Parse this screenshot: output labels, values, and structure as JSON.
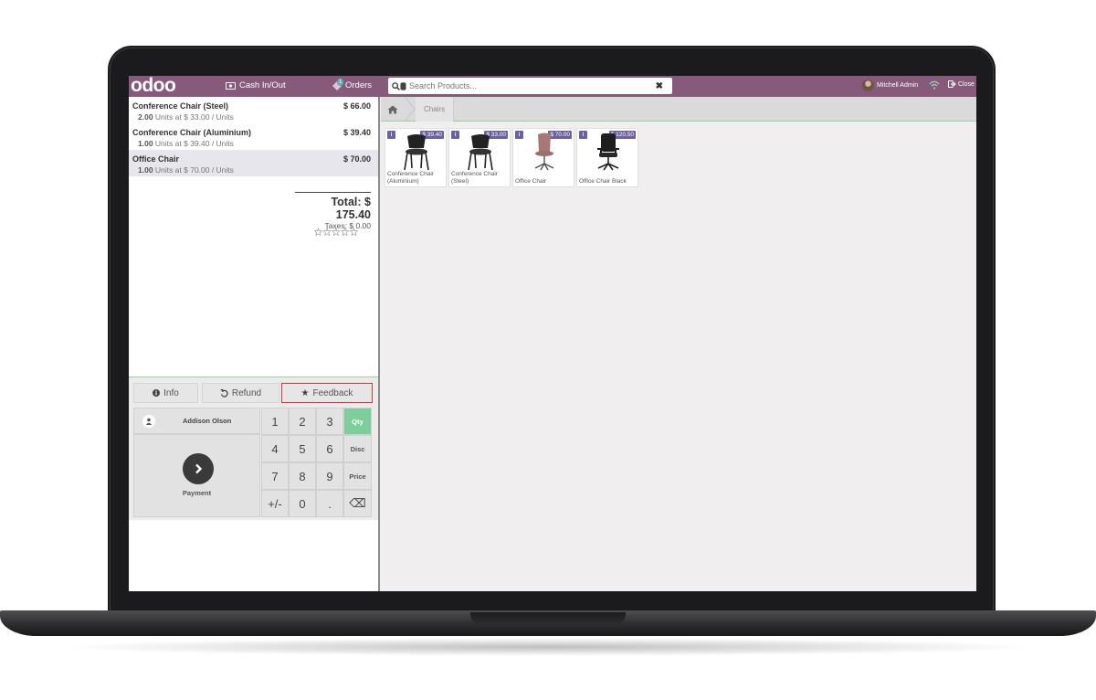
{
  "topbar": {
    "logo": "odoo",
    "cash_label": "Cash In/Out",
    "orders_label": "Orders",
    "orders_count": "1",
    "search_placeholder": "Search Products...",
    "user_name": "Mitchell Admin",
    "close_label": "Close",
    "brand_color": "#875a7b"
  },
  "order": {
    "lines": [
      {
        "name": "Conference Chair (Steel)",
        "qty": "2.00",
        "info": "Units at $ 33.00 / Units",
        "price": "$ 66.00"
      },
      {
        "name": "Conference Chair (Aluminium)",
        "qty": "1.00",
        "info": "Units at $ 39.40 / Units",
        "price": "$ 39.40"
      },
      {
        "name": "Office Chair",
        "qty": "1.00",
        "info": "Units at $ 70.00 / Units",
        "price": "$ 70.00"
      }
    ],
    "total": "Total: $ 175.40",
    "taxes": "Taxes: $ 0.00",
    "rating_stars": "☆☆☆☆☆"
  },
  "controls": {
    "info_label": "Info",
    "refund_label": "Refund",
    "feedback_label": "Feedback",
    "customer_name": "Addison Olson",
    "payment_label": "Payment",
    "keys": [
      "1",
      "2",
      "3",
      "Qty",
      "4",
      "5",
      "6",
      "Disc",
      "7",
      "8",
      "9",
      "Price",
      "+/-",
      "0",
      ".",
      "⌫"
    ],
    "active_mode": "Qty",
    "active_color": "#7ccf9a"
  },
  "breadcrumb": {
    "category": "Chairs"
  },
  "products": [
    {
      "name": "Conference Chair (Aluminium)",
      "price": "$ 39.40",
      "icon": "conference-chair-icon"
    },
    {
      "name": "Conference Chair (Steel)",
      "price": "$ 33.00",
      "icon": "conference-chair-icon"
    },
    {
      "name": "Office Chair",
      "price": "$ 70.00",
      "icon": "office-chair-pink-icon"
    },
    {
      "name": "Office Chair Black",
      "price": "$ 120.50",
      "icon": "office-chair-black-icon"
    }
  ]
}
